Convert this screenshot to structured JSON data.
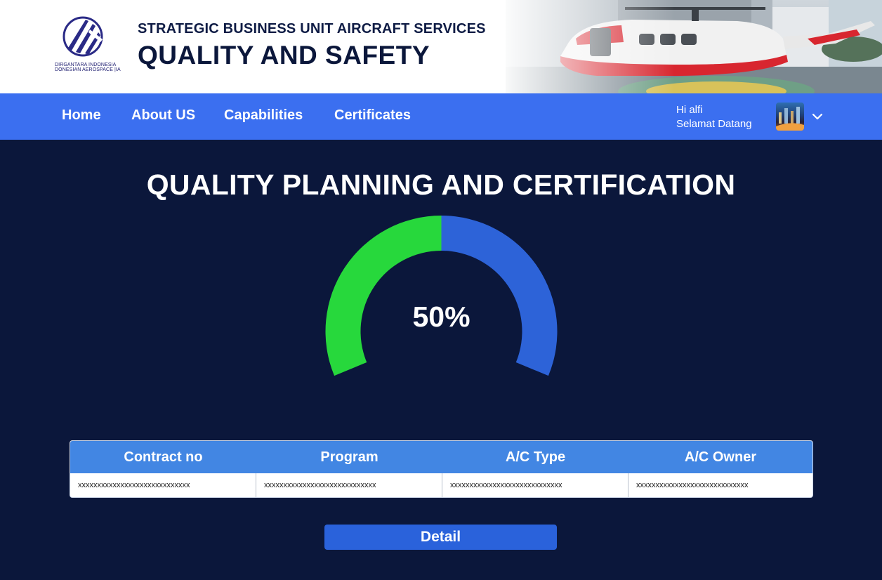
{
  "header": {
    "logo_line1": "DIRGANTARA INDONESIA",
    "logo_line2": "DONESIAN AEROSPACE |IA",
    "subtitle": "STRATEGIC BUSINESS UNIT AIRCRAFT SERVICES",
    "title": "QUALITY AND SAFETY"
  },
  "nav": {
    "items": [
      {
        "label": "Home"
      },
      {
        "label": "About US"
      },
      {
        "label": "Capabilities"
      },
      {
        "label": "Certificates"
      }
    ],
    "greeting": "Hi alfi",
    "welcome": "Selamat Datang"
  },
  "main": {
    "heading": "QUALITY PLANNING AND CERTIFICATION",
    "gauge": {
      "value_label": "50%",
      "percent": 50
    },
    "table": {
      "headers": [
        "Contract no",
        "Program",
        "A/C Type",
        "A/C Owner"
      ],
      "rows": [
        [
          "xxxxxxxxxxxxxxxxxxxxxxxxxxxxx",
          "xxxxxxxxxxxxxxxxxxxxxxxxxxxxx",
          "xxxxxxxxxxxxxxxxxxxxxxxxxxxxx",
          "xxxxxxxxxxxxxxxxxxxxxxxxxxxxx"
        ]
      ]
    },
    "detail_label": "Detail"
  },
  "colors": {
    "background": "#0b173b",
    "nav": "#3b6ff0",
    "gauge_done": "#27d83c",
    "gauge_remaining": "#2d63d8",
    "table_header": "#4286e3",
    "button": "#2a62db"
  },
  "icons": {
    "logo": "ptdi-logo",
    "dropdown": "chevron-down-icon"
  }
}
